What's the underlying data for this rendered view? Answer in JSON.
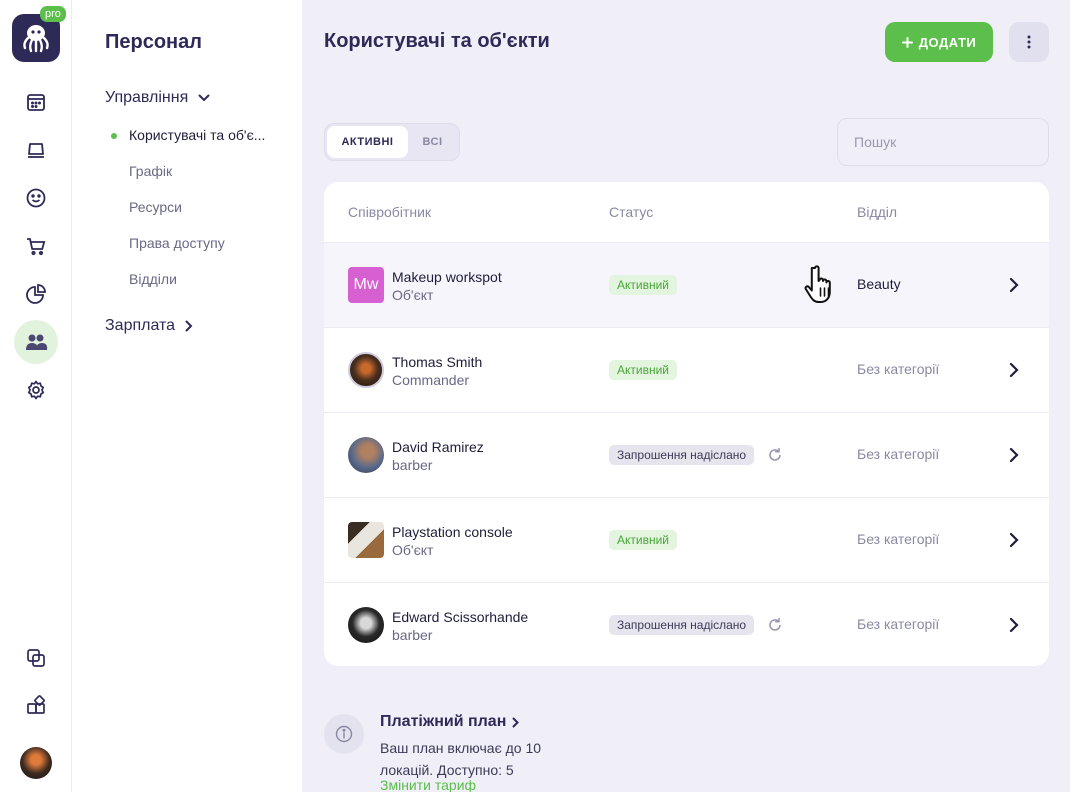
{
  "rail": {
    "logo_badge": "pro",
    "items": [
      {
        "name": "calendar-icon",
        "active": false
      },
      {
        "name": "laptop-icon",
        "active": false
      },
      {
        "name": "smiley-icon",
        "active": false
      },
      {
        "name": "cart-icon",
        "active": false
      },
      {
        "name": "pie-chart-icon",
        "active": false
      },
      {
        "name": "users-icon",
        "active": true
      },
      {
        "name": "gear-icon",
        "active": false
      }
    ],
    "bottom_items": [
      {
        "name": "copy-icon"
      },
      {
        "name": "widgets-icon"
      }
    ]
  },
  "sidebar": {
    "title": "Персонал",
    "group_management": "Управління",
    "items": [
      {
        "label": "Користувачі та об'є...",
        "active": true
      },
      {
        "label": "Графік",
        "active": false
      },
      {
        "label": "Ресурси",
        "active": false
      },
      {
        "label": "Права доступу",
        "active": false
      },
      {
        "label": "Відділи",
        "active": false
      }
    ],
    "group_salary": "Зарплата"
  },
  "header": {
    "title": "Користувачі та об'єкти",
    "add_label": "ДОДАТИ"
  },
  "tabs": {
    "active": "АКТИВНІ",
    "all": "ВСІ"
  },
  "search": {
    "placeholder": "Пошук"
  },
  "table": {
    "columns": [
      "Співробітник",
      "Статус",
      "Відділ"
    ],
    "rows": [
      {
        "initials": "Mw",
        "name": "Makeup workspot",
        "role": "Об'єкт",
        "status": "Активний",
        "status_type": "active",
        "department": "Beauty"
      },
      {
        "name": "Thomas Smith",
        "role": "Commander",
        "status": "Активний",
        "status_type": "active",
        "department": "Без категорії"
      },
      {
        "name": "David Ramirez",
        "role": "barber",
        "status": "Запрошення надіслано",
        "status_type": "invited",
        "department": "Без категорії"
      },
      {
        "name": "Playstation console",
        "role": "Об'єкт",
        "status": "Активний",
        "status_type": "active",
        "department": "Без категорії"
      },
      {
        "name": "Edward Scissorhande",
        "role": "barber",
        "status": "Запрошення надіслано",
        "status_type": "invited",
        "department": "Без категорії"
      }
    ]
  },
  "plan": {
    "title": "Платіжний план",
    "text": "Ваш план включає до 10 локацій. Доступно: 5",
    "link": "Змінити тариф"
  },
  "colors": {
    "accent": "#5cbf4b",
    "brand": "#2e2a57",
    "background": "#f0eff8"
  }
}
